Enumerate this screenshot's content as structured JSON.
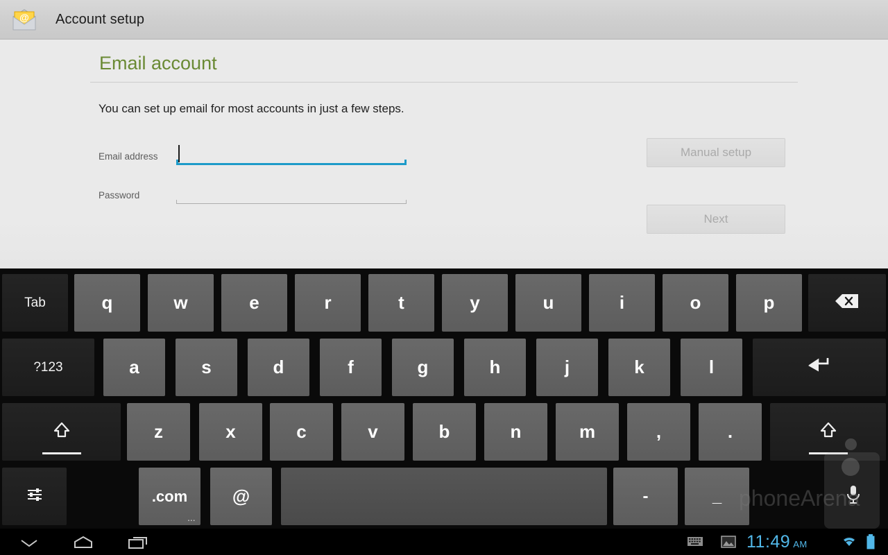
{
  "titlebar": {
    "icon": "email-app-icon",
    "title": "Account setup"
  },
  "main": {
    "page_title": "Email account",
    "intro": "You can set up email for most accounts in just a few steps.",
    "fields": [
      {
        "label": "Email address",
        "value": "",
        "placeholder": "",
        "focused": true
      },
      {
        "label": "Password",
        "value": "",
        "placeholder": "",
        "focused": false
      }
    ],
    "buttons": [
      {
        "label": "Manual setup",
        "disabled": true
      },
      {
        "label": "Next",
        "disabled": true
      }
    ]
  },
  "keyboard": {
    "row1": [
      {
        "label": "Tab",
        "type": "func",
        "name": "tab"
      },
      {
        "label": "q",
        "type": "letter",
        "name": "q"
      },
      {
        "label": "w",
        "type": "letter",
        "name": "w"
      },
      {
        "label": "e",
        "type": "letter",
        "name": "e"
      },
      {
        "label": "r",
        "type": "letter",
        "name": "r"
      },
      {
        "label": "t",
        "type": "letter",
        "name": "t"
      },
      {
        "label": "y",
        "type": "letter",
        "name": "y"
      },
      {
        "label": "u",
        "type": "letter",
        "name": "u"
      },
      {
        "label": "i",
        "type": "letter",
        "name": "i"
      },
      {
        "label": "o",
        "type": "letter",
        "name": "o"
      },
      {
        "label": "p",
        "type": "letter",
        "name": "p"
      },
      {
        "label": "",
        "type": "func",
        "name": "backspace",
        "icon": "backspace-icon"
      }
    ],
    "row2": [
      {
        "label": "?123",
        "type": "func",
        "name": "symbols"
      },
      {
        "label": "a",
        "type": "letter",
        "name": "a"
      },
      {
        "label": "s",
        "type": "letter",
        "name": "s"
      },
      {
        "label": "d",
        "type": "letter",
        "name": "d"
      },
      {
        "label": "f",
        "type": "letter",
        "name": "f"
      },
      {
        "label": "g",
        "type": "letter",
        "name": "g"
      },
      {
        "label": "h",
        "type": "letter",
        "name": "h"
      },
      {
        "label": "j",
        "type": "letter",
        "name": "j"
      },
      {
        "label": "k",
        "type": "letter",
        "name": "k"
      },
      {
        "label": "l",
        "type": "letter",
        "name": "l"
      },
      {
        "label": "",
        "type": "func",
        "name": "enter",
        "icon": "enter-icon"
      }
    ],
    "row3": [
      {
        "label": "",
        "type": "func",
        "name": "shift-left",
        "icon": "shift-icon"
      },
      {
        "label": "z",
        "type": "letter",
        "name": "z"
      },
      {
        "label": "x",
        "type": "letter",
        "name": "x"
      },
      {
        "label": "c",
        "type": "letter",
        "name": "c"
      },
      {
        "label": "v",
        "type": "letter",
        "name": "v"
      },
      {
        "label": "b",
        "type": "letter",
        "name": "b"
      },
      {
        "label": "n",
        "type": "letter",
        "name": "n"
      },
      {
        "label": "m",
        "type": "letter",
        "name": "m"
      },
      {
        "label": ",",
        "type": "letter",
        "name": "comma"
      },
      {
        "label": ".",
        "type": "letter",
        "name": "period"
      },
      {
        "label": "",
        "type": "func",
        "name": "shift-right",
        "icon": "shift-icon"
      }
    ],
    "row4": [
      {
        "label": "",
        "type": "func",
        "name": "settings",
        "icon": "sliders-icon"
      },
      {
        "label": ".com",
        "type": "letter",
        "name": "dot-com",
        "popup": "..."
      },
      {
        "label": "@",
        "type": "letter",
        "name": "at-sign"
      },
      {
        "label": "",
        "type": "space",
        "name": "space"
      },
      {
        "label": "-",
        "type": "letter",
        "name": "hyphen"
      },
      {
        "label": "_",
        "type": "letter",
        "name": "underscore"
      },
      {
        "label": "",
        "type": "func",
        "name": "voice-input",
        "icon": "microphone-icon"
      }
    ]
  },
  "navbar": {
    "back": "back-icon",
    "home": "home-icon",
    "recents": "recent-apps-icon",
    "keyboard_indicator": "keyboard-icon",
    "screenshot_indicator": "screenshot-icon",
    "time": "11:49",
    "ampm": "AM",
    "wifi": "wifi-icon",
    "battery": "battery-icon"
  },
  "watermark": {
    "text": "phoneArena"
  },
  "colors": {
    "accent_green": "#6a8a34",
    "focus_blue": "#1d9bc9",
    "clock_blue": "#51b7e8",
    "titlebar_bg": "#d0d0d0",
    "content_bg": "#eaeaea",
    "keyboard_bg": "#0a0a0a",
    "key_letter": "#656565",
    "key_func": "#202020"
  }
}
